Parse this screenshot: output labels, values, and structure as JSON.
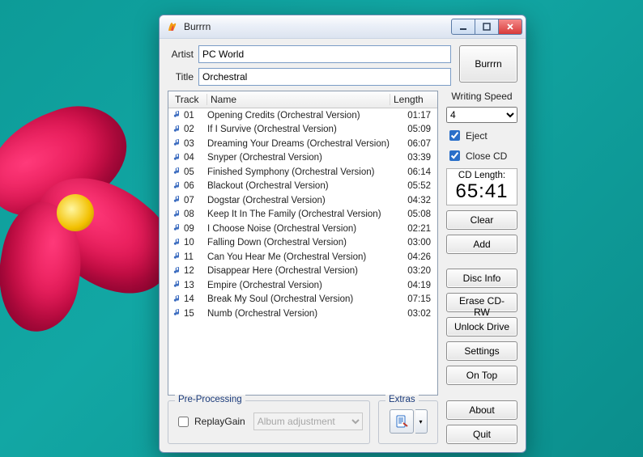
{
  "window": {
    "title": "Burrrn"
  },
  "meta": {
    "artist_label": "Artist",
    "title_label": "Title",
    "artist_value": "PC World",
    "title_value": "Orchestral"
  },
  "burn_button": "Burrrn",
  "columns": {
    "track": "Track",
    "name": "Name",
    "length": "Length"
  },
  "tracks": [
    {
      "num": "01",
      "name": "Opening Credits (Orchestral Version)",
      "length": "01:17"
    },
    {
      "num": "02",
      "name": "If I Survive (Orchestral Version)",
      "length": "05:09"
    },
    {
      "num": "03",
      "name": "Dreaming Your Dreams (Orchestral Version)",
      "length": "06:07"
    },
    {
      "num": "04",
      "name": "Snyper (Orchestral Version)",
      "length": "03:39"
    },
    {
      "num": "05",
      "name": "Finished Symphony (Orchestral Version)",
      "length": "06:14"
    },
    {
      "num": "06",
      "name": "Blackout (Orchestral Version)",
      "length": "05:52"
    },
    {
      "num": "07",
      "name": "Dogstar (Orchestral Version)",
      "length": "04:32"
    },
    {
      "num": "08",
      "name": "Keep It In The Family (Orchestral Version)",
      "length": "05:08"
    },
    {
      "num": "09",
      "name": "I Choose Noise (Orchestral Version)",
      "length": "02:21"
    },
    {
      "num": "10",
      "name": "Falling Down (Orchestral Version)",
      "length": "03:00"
    },
    {
      "num": "11",
      "name": "Can You Hear Me (Orchestral Version)",
      "length": "04:26"
    },
    {
      "num": "12",
      "name": "Disappear Here (Orchestral Version)",
      "length": "03:20"
    },
    {
      "num": "13",
      "name": "Empire (Orchestral Version)",
      "length": "04:19"
    },
    {
      "num": "14",
      "name": "Break My Soul (Orchestral Version)",
      "length": "07:15"
    },
    {
      "num": "15",
      "name": "Numb (Orchestral Version)",
      "length": "03:02"
    }
  ],
  "side": {
    "writing_speed_label": "Writing Speed",
    "writing_speed_value": "4",
    "eject_label": "Eject",
    "eject_checked": true,
    "close_cd_label": "Close CD",
    "close_cd_checked": true,
    "cd_length_label": "CD Length:",
    "cd_length_value": "65:41",
    "clear": "Clear",
    "add": "Add",
    "disc_info": "Disc Info",
    "erase": "Erase CD-RW",
    "unlock": "Unlock Drive",
    "settings": "Settings",
    "on_top": "On Top",
    "about": "About",
    "quit": "Quit"
  },
  "preproc": {
    "legend": "Pre-Processing",
    "replaygain_label": "ReplayGain",
    "replaygain_checked": false,
    "mode_value": "Album adjustment"
  },
  "extras": {
    "legend": "Extras"
  }
}
